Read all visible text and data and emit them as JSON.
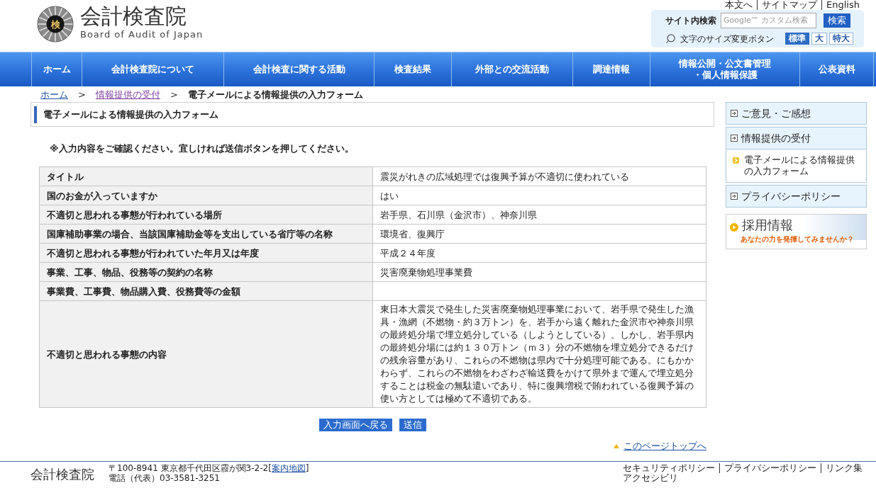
{
  "top_links": [
    "本文へ",
    "サイトマップ",
    "English"
  ],
  "header": {
    "emblem_glyph": "検",
    "title": "会計検査院",
    "subtitle": "Board of Audit of Japan"
  },
  "search": {
    "label": "サイト内検索",
    "placeholder": "Google™ カスタム検索",
    "button": "検索"
  },
  "text_size": {
    "label": "文字のサイズ変更ボタン",
    "options": [
      {
        "label": "標準",
        "selected": true
      },
      {
        "label": "大",
        "selected": false
      },
      {
        "label": "特大",
        "selected": false
      }
    ]
  },
  "nav": [
    "ホーム",
    "会計検査院について",
    "会計検査に関する活動",
    "検査結果",
    "外部との交流活動",
    "調達情報",
    "情報公開・公文書管理・個人情報保護",
    "公表資料"
  ],
  "breadcrumb": [
    {
      "kind": "link",
      "label": "ホーム"
    },
    {
      "kind": "separator",
      "label": ">"
    },
    {
      "kind": "visited",
      "label": "情報提供の受付"
    },
    {
      "kind": "separator",
      "label": ">"
    },
    {
      "kind": "current",
      "label": "電子メールによる情報提供の入力フォーム"
    }
  ],
  "page_heading": "電子メールによる情報提供の入力フォーム",
  "note": "※入力内容をご確認ください。宜しければ送信ボタンを押してください。",
  "table": {
    "rows": [
      {
        "label": "タイトル",
        "value": "震災がれきの広域処理では復興予算が不適切に使われている"
      },
      {
        "label": "国のお金が入っていますか",
        "value": "はい"
      },
      {
        "label": "不適切と思われる事態が行われている場所",
        "value": "岩手県、石川県（金沢市）、神奈川県"
      },
      {
        "label": "国庫補助事業の場合、当該国庫補助金等を支出している省庁等の名称",
        "value": "環境省、復興庁"
      },
      {
        "label": "不適切と思われる事態が行われていた年月又は年度",
        "value": "平成２４年度"
      },
      {
        "label": "事業、工事、物品、役務等の契約の名称",
        "value": "災害廃棄物処理事業費"
      },
      {
        "label": "事業費、工事費、物品購入費、役務費等の金額"
      },
      {
        "label": "不適切と思われる事態の内容",
        "value": "東日本大震災で発生した災害廃棄物処理事業において、岩手県で発生した漁具・漁網（不燃物・約３万トン）を、岩手から遠く離れた金沢市や神奈川県の最終処分場で埋立処分している（しようとしている）。しかし、岩手県内の最終処分場には約１３０万トン（ｍ３）分の不燃物を埋立処分できるだけの残余容量があり、これらの不燃物は県内で十分処理可能である。にもかかわらず、これらの不燃物をわざわざ輸送費をかけて県外まで運んで埋立処分することは税金の無駄遣いであり、特に復興増税で賄われている復興予算の使い方としては極めて不適切である。"
      }
    ]
  },
  "buttons": [
    "入力画面へ戻る",
    "送信"
  ],
  "page_top_link": "このページトップへ",
  "sidebar": {
    "items": [
      {
        "label": "ご意見・ご感想"
      },
      {
        "label": "情報提供の受付",
        "children": [
          {
            "label": "電子メールによる情報提供の入力フォーム"
          }
        ]
      },
      {
        "label": "プライバシーポリシー"
      }
    ],
    "banner": {
      "title": "採用情報",
      "tagline": "あなたの力を発揮してみませんか？"
    }
  },
  "footer": {
    "name": "会計検査院",
    "address_before": "〒100-8941 東京都千代田区霞が関3-2-2[",
    "map_link": "案内地図",
    "address_after": "]",
    "phone": "電話（代表）03-3581-3251",
    "links": [
      "セキュリティポリシー",
      "プライバシーポリシー",
      "リンク集"
    ],
    "links_2": [
      "アクセシビリ"
    ]
  }
}
